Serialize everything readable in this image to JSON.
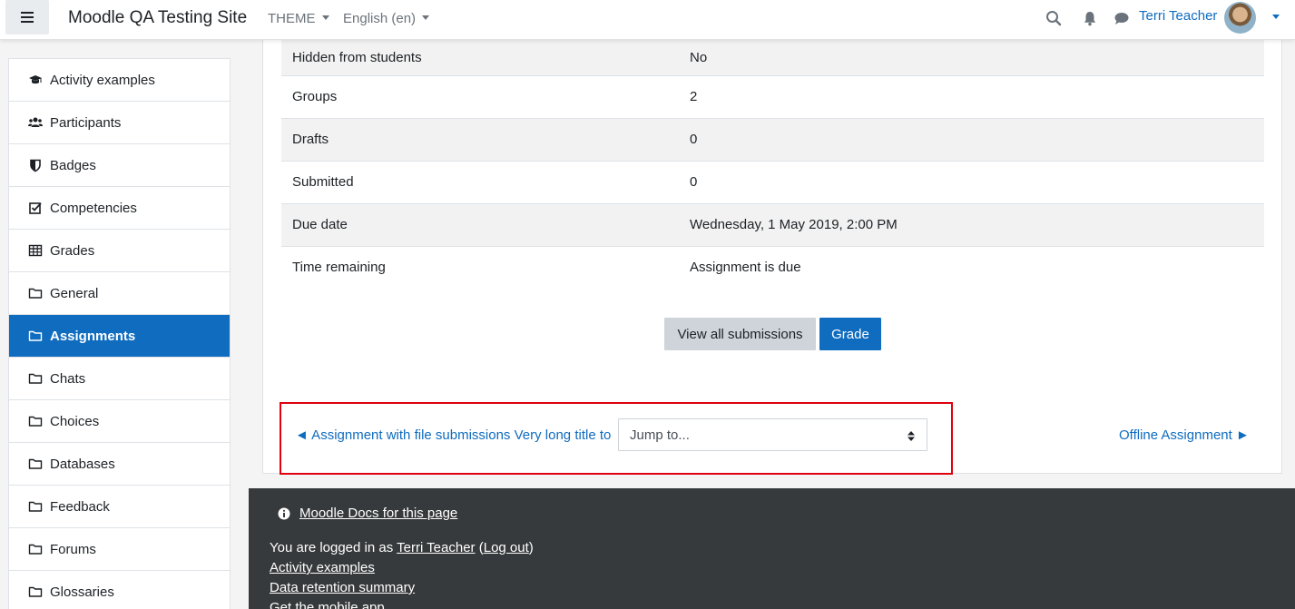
{
  "navbar": {
    "site_name": "Moodle QA Testing Site",
    "theme_menu": "THEME",
    "language_menu": "English (en)",
    "user_name": "Terri Teacher"
  },
  "sidebar": {
    "items": [
      {
        "label": "Activity examples",
        "icon": "graduation-cap-icon"
      },
      {
        "label": "Participants",
        "icon": "users-icon"
      },
      {
        "label": "Badges",
        "icon": "shield-icon"
      },
      {
        "label": "Competencies",
        "icon": "checkbox-icon"
      },
      {
        "label": "Grades",
        "icon": "table-icon"
      },
      {
        "label": "General",
        "icon": "folder-icon"
      },
      {
        "label": "Assignments",
        "icon": "folder-icon",
        "active": true
      },
      {
        "label": "Chats",
        "icon": "folder-icon"
      },
      {
        "label": "Choices",
        "icon": "folder-icon"
      },
      {
        "label": "Databases",
        "icon": "folder-icon"
      },
      {
        "label": "Feedback",
        "icon": "folder-icon"
      },
      {
        "label": "Forums",
        "icon": "folder-icon"
      },
      {
        "label": "Glossaries",
        "icon": "folder-icon"
      }
    ]
  },
  "grading_summary": {
    "rows": [
      {
        "label": "Hidden from students",
        "value": "No"
      },
      {
        "label": "Groups",
        "value": "2"
      },
      {
        "label": "Drafts",
        "value": "0"
      },
      {
        "label": "Submitted",
        "value": "0"
      },
      {
        "label": "Due date",
        "value": "Wednesday, 1 May 2019, 2:00 PM"
      },
      {
        "label": "Time remaining",
        "value": "Assignment is due"
      }
    ]
  },
  "actions": {
    "view_all_label": "View all submissions",
    "grade_label": "Grade"
  },
  "activity_nav": {
    "prev_label": "◄ Assignment with file submissions Very long title to",
    "jump_placeholder": "Jump to...",
    "next_label": "Offline Assignment ►"
  },
  "footer": {
    "docs_link": "Moodle Docs for this page",
    "logged_in_prefix": "You are logged in as ",
    "logged_in_user": "Terri Teacher",
    "logout_label": "Log out",
    "links": [
      "Activity examples",
      "Data retention summary",
      "Get the mobile app"
    ]
  },
  "colors": {
    "brand_blue": "#0f6cbf",
    "footer_bg": "#373a3c",
    "highlight_border": "#e0000e"
  }
}
